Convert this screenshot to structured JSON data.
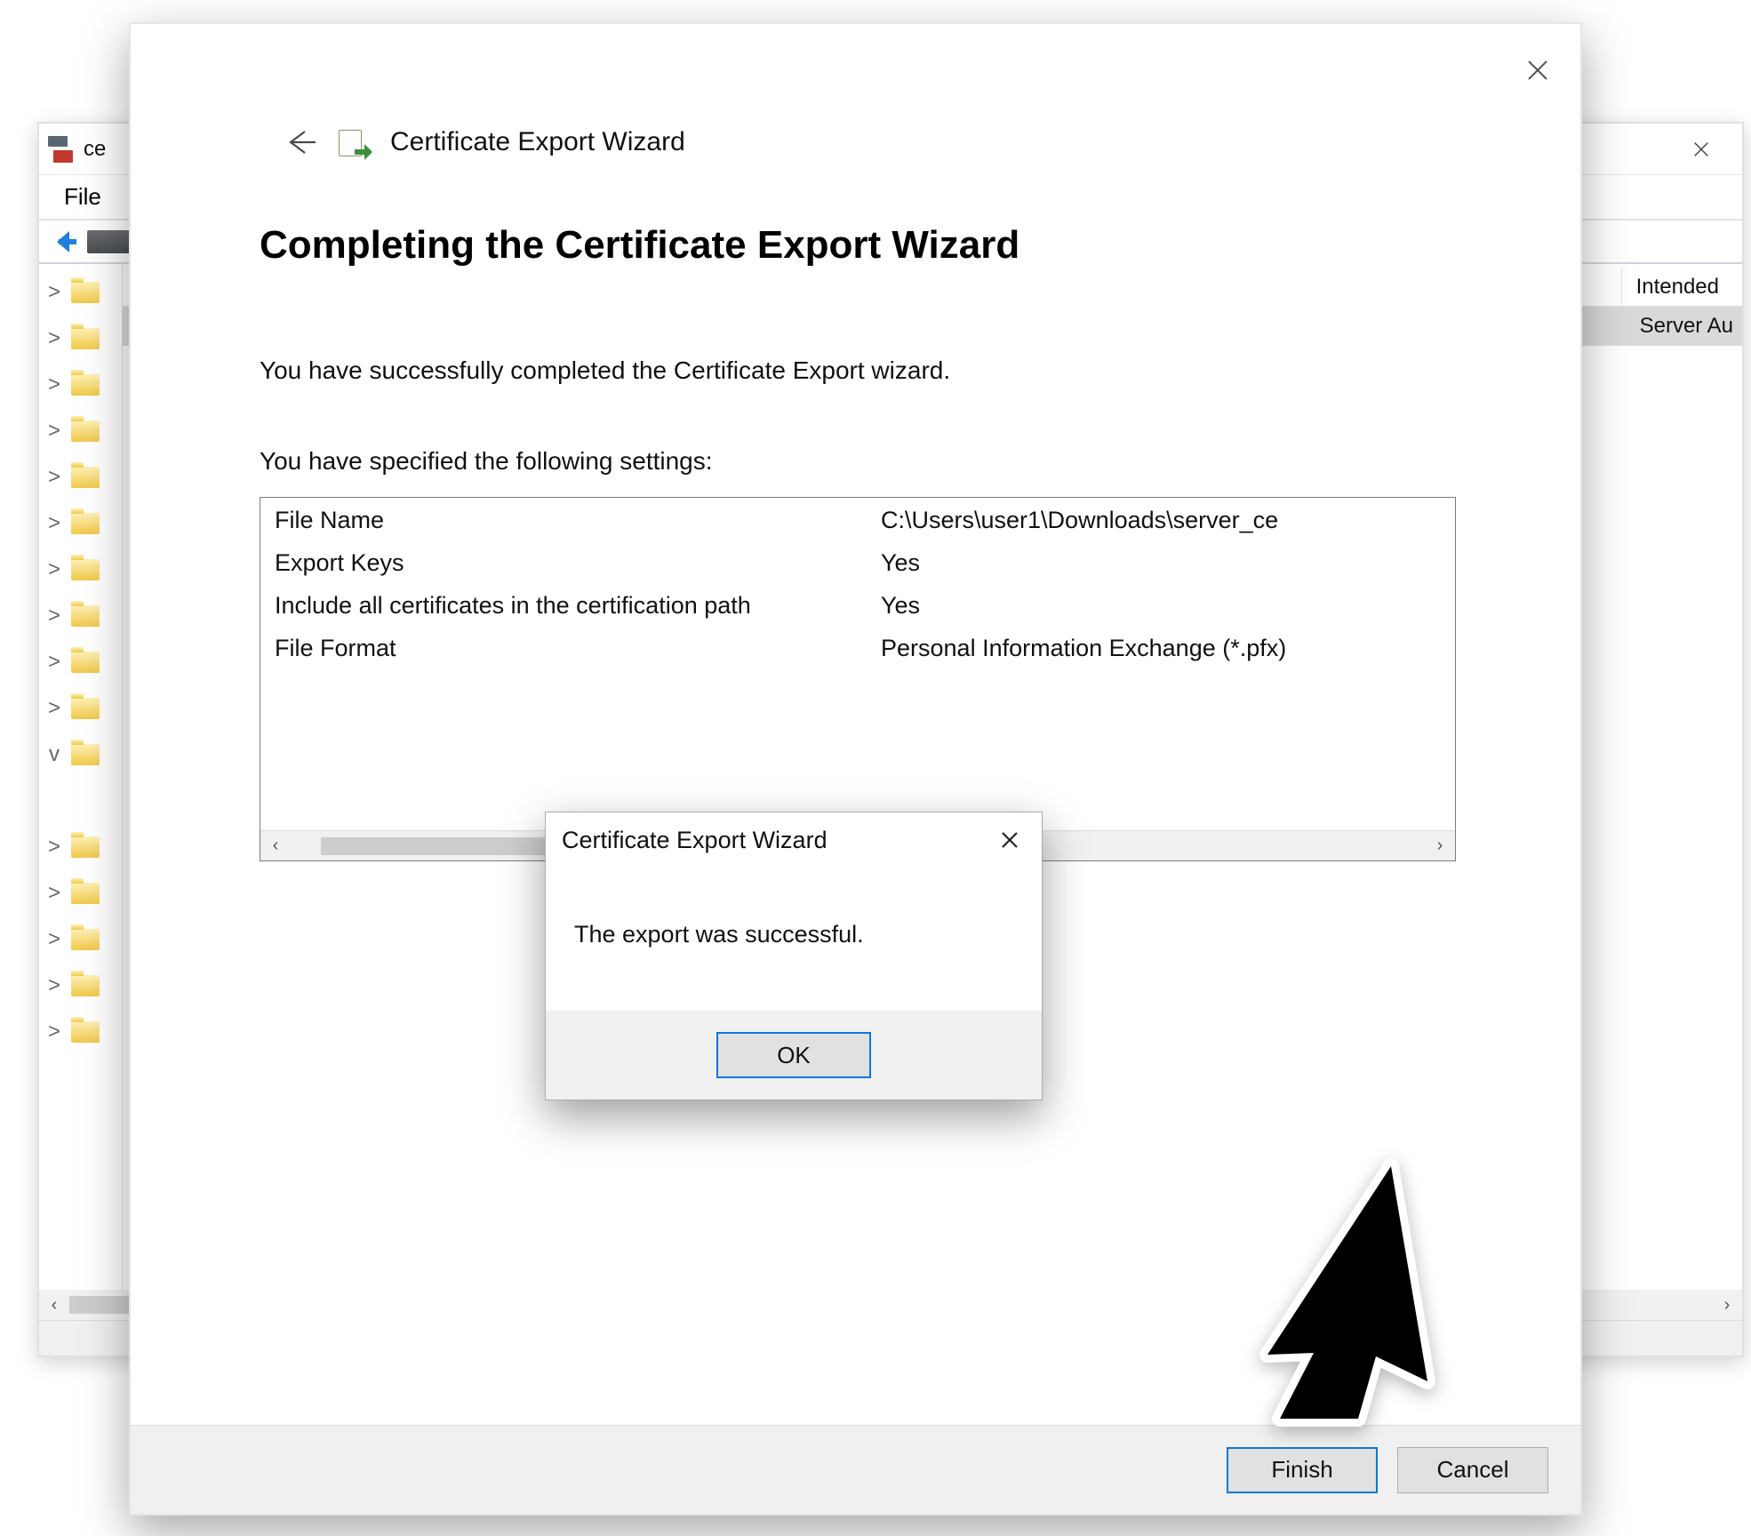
{
  "mmc": {
    "title": "ce",
    "menu": {
      "file": "File"
    },
    "tree_rows": [
      {
        "caret": ">",
        "kind": "folder"
      },
      {
        "caret": ">",
        "kind": "folder"
      },
      {
        "caret": ">",
        "kind": "folder"
      },
      {
        "caret": ">",
        "kind": "folder"
      },
      {
        "caret": ">",
        "kind": "folder"
      },
      {
        "caret": ">",
        "kind": "folder"
      },
      {
        "caret": ">",
        "kind": "folder"
      },
      {
        "caret": ">",
        "kind": "folder"
      },
      {
        "caret": ">",
        "kind": "folder"
      },
      {
        "caret": ">",
        "kind": "folder"
      },
      {
        "caret": "v",
        "kind": "folder"
      },
      {
        "caret": "",
        "kind": "gap"
      },
      {
        "caret": ">",
        "kind": "folder"
      },
      {
        "caret": ">",
        "kind": "folder"
      },
      {
        "caret": ">",
        "kind": "folder"
      },
      {
        "caret": ">",
        "kind": "folder"
      },
      {
        "caret": ">",
        "kind": "folder"
      }
    ],
    "list_header_col": "Intended",
    "list_row0_text": "Server Au"
  },
  "wizard": {
    "title": "Certificate Export Wizard",
    "heading": "Completing the Certificate Export Wizard",
    "success_line": "You have successfully completed the Certificate Export wizard.",
    "settings_intro": "You have specified the following settings:",
    "settings": [
      {
        "label": "File Name",
        "value": "C:\\Users\\user1\\Downloads\\server_ce"
      },
      {
        "label": "Export Keys",
        "value": "Yes"
      },
      {
        "label": "Include all certificates in the certification path",
        "value": "Yes"
      },
      {
        "label": "File Format",
        "value": "Personal Information Exchange (*.pfx)"
      }
    ],
    "finish": "Finish",
    "cancel": "Cancel"
  },
  "msg": {
    "title": "Certificate Export Wizard",
    "body": "The export was successful.",
    "ok": "OK"
  }
}
